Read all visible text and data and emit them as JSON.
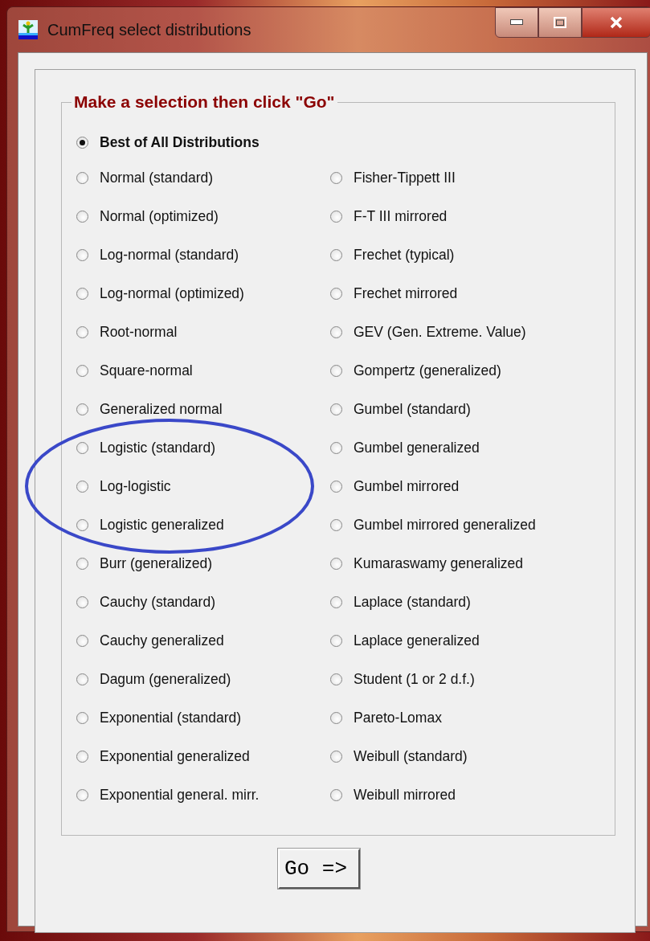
{
  "window": {
    "title": "CumFreq select distributions"
  },
  "group": {
    "title": "Make a selection then click \"Go\""
  },
  "best_option": {
    "label": "Best of All Distributions",
    "selected": true
  },
  "columns": [
    {
      "options": [
        {
          "label": "Normal (standard)",
          "selected": false
        },
        {
          "label": "Normal (optimized)",
          "selected": false
        },
        {
          "label": "Log-normal (standard)",
          "selected": false
        },
        {
          "label": "Log-normal (optimized)",
          "selected": false
        },
        {
          "label": "Root-normal",
          "selected": false
        },
        {
          "label": "Square-normal",
          "selected": false
        },
        {
          "label": "Generalized normal",
          "selected": false
        },
        {
          "label": "Logistic (standard)",
          "selected": false
        },
        {
          "label": "Log-logistic",
          "selected": false
        },
        {
          "label": "Logistic generalized",
          "selected": false
        },
        {
          "label": "Burr (generalized)",
          "selected": false
        },
        {
          "label": "Cauchy (standard)",
          "selected": false
        },
        {
          "label": "Cauchy generalized",
          "selected": false
        },
        {
          "label": "Dagum (generalized)",
          "selected": false
        },
        {
          "label": "Exponential (standard)",
          "selected": false
        },
        {
          "label": "Exponential generalized",
          "selected": false
        },
        {
          "label": "Exponential general. mirr.",
          "selected": false
        }
      ]
    },
    {
      "options": [
        {
          "label": "Fisher-Tippett III",
          "selected": false
        },
        {
          "label": "F-T III mirrored",
          "selected": false
        },
        {
          "label": "Frechet (typical)",
          "selected": false
        },
        {
          "label": "Frechet mirrored",
          "selected": false
        },
        {
          "label": "GEV (Gen. Extreme. Value)",
          "selected": false
        },
        {
          "label": "Gompertz (generalized)",
          "selected": false
        },
        {
          "label": "Gumbel (standard)",
          "selected": false
        },
        {
          "label": "Gumbel generalized",
          "selected": false
        },
        {
          "label": "Gumbel mirrored",
          "selected": false
        },
        {
          "label": "Gumbel mirrored generalized",
          "selected": false
        },
        {
          "label": "Kumaraswamy generalized",
          "selected": false
        },
        {
          "label": "Laplace (standard)",
          "selected": false
        },
        {
          "label": "Laplace generalized",
          "selected": false
        },
        {
          "label": "Student (1 or 2 d.f.)",
          "selected": false
        },
        {
          "label": "Pareto-Lomax",
          "selected": false
        },
        {
          "label": "Weibull (standard)",
          "selected": false
        },
        {
          "label": "Weibull mirrored",
          "selected": false
        }
      ]
    }
  ],
  "go_button": {
    "label": "Go =>"
  }
}
